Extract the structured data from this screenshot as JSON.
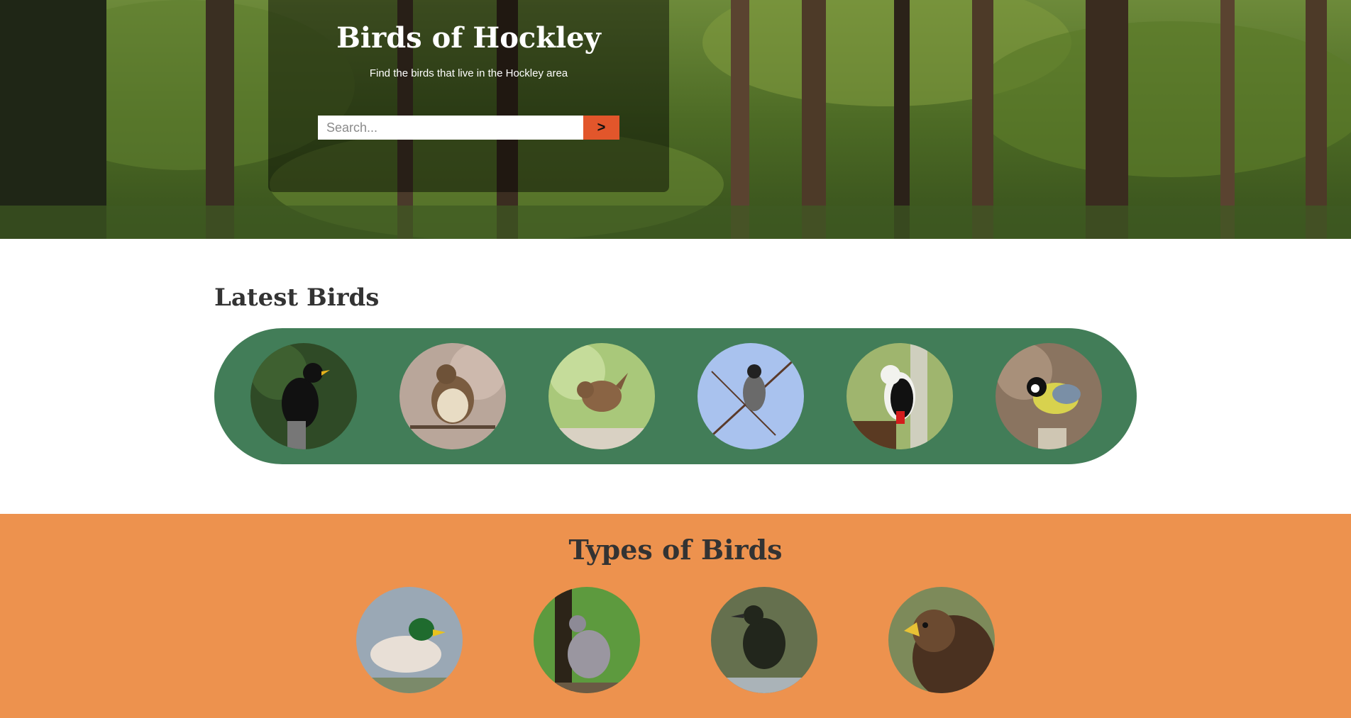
{
  "hero": {
    "title": "Birds of Hockley",
    "subtitle": "Find the birds that live in the Hockley area",
    "search_placeholder": "Search...",
    "search_button_label": ">"
  },
  "latest": {
    "heading": "Latest Birds",
    "birds": [
      {
        "image": "blackbird-photo"
      },
      {
        "image": "song-thrush-photo"
      },
      {
        "image": "wren-photo"
      },
      {
        "image": "blackcap-photo"
      },
      {
        "image": "great-spotted-woodpecker-photo"
      },
      {
        "image": "great-tit-photo"
      }
    ]
  },
  "types": {
    "heading": "Types of Birds",
    "birds": [
      {
        "image": "mallard-duck-photo"
      },
      {
        "image": "wood-pigeon-photo"
      },
      {
        "image": "starling-photo"
      },
      {
        "image": "eagle-photo"
      }
    ]
  },
  "colors": {
    "accent_orange": "#ed924e",
    "search_button": "#e2562b",
    "strip_green": "#427d58",
    "heading_text": "#333333"
  }
}
